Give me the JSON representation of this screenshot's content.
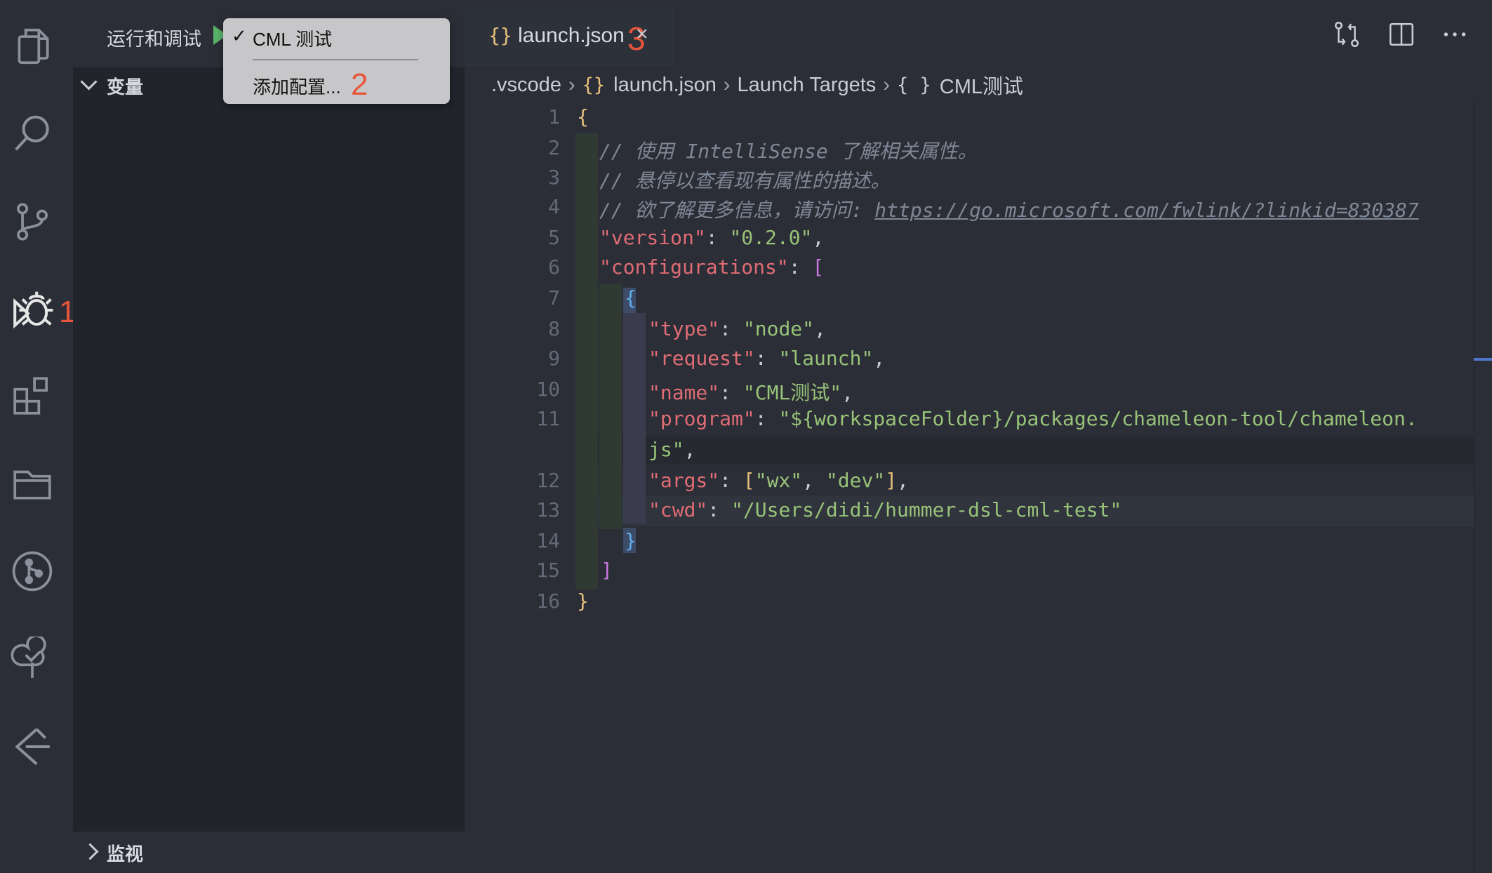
{
  "activity_bar": {
    "items": [
      "explorer-icon",
      "search-icon",
      "source-control-icon",
      "run-debug-icon",
      "extensions-icon",
      "folder-icon",
      "git-graph-icon",
      "tree-icon",
      "gitlens-icon"
    ],
    "annotation_1": "1"
  },
  "sidebar": {
    "title": "运行和调试",
    "variables_label": "变量",
    "watch_label": "监视"
  },
  "dropdown": {
    "check": "✓",
    "selected": "CML 测试",
    "add_config": "添加配置...",
    "annotation_2": "2"
  },
  "tab": {
    "icon": "{}",
    "label": "launch.json",
    "close": "×",
    "annotation_3": "3"
  },
  "breadcrumb": {
    "folder": ".vscode",
    "file_icon": "{}",
    "file": "launch.json",
    "section": "Launch Targets",
    "obj_icon": "{ }",
    "item": "CML测试"
  },
  "editor": {
    "line_numbers": [
      "1",
      "2",
      "3",
      "4",
      "5",
      "6",
      "7",
      "8",
      "9",
      "10",
      "11",
      "12",
      "13",
      "14",
      "15",
      "16"
    ],
    "comment1": "// 使用 IntelliSense 了解相关属性。",
    "comment2": "// 悬停以查看现有属性的描述。",
    "comment3_prefix": "// 欲了解更多信息，请访问: ",
    "comment3_url": "https://go.microsoft.com/fwlink/?linkid=830387",
    "version_key": "\"version\"",
    "version_val": "\"0.2.0\"",
    "configurations_key": "\"configurations\"",
    "type_key": "\"type\"",
    "type_val": "\"node\"",
    "request_key": "\"request\"",
    "request_val": "\"launch\"",
    "name_key": "\"name\"",
    "name_val": "\"CML测试\"",
    "program_key": "\"program\"",
    "program_val_1": "\"${workspaceFolder}/packages/chameleon-tool/chameleon.",
    "program_val_2": "js\"",
    "args_key": "\"args\"",
    "args_val_1": "\"wx\"",
    "args_val_2": "\"dev\"",
    "cwd_key": "\"cwd\"",
    "cwd_val": "\"/Users/didi/hummer-dsl-cml-test\""
  },
  "colors": {
    "accent_annotation": "#e8553a",
    "play": "#59b36a"
  }
}
